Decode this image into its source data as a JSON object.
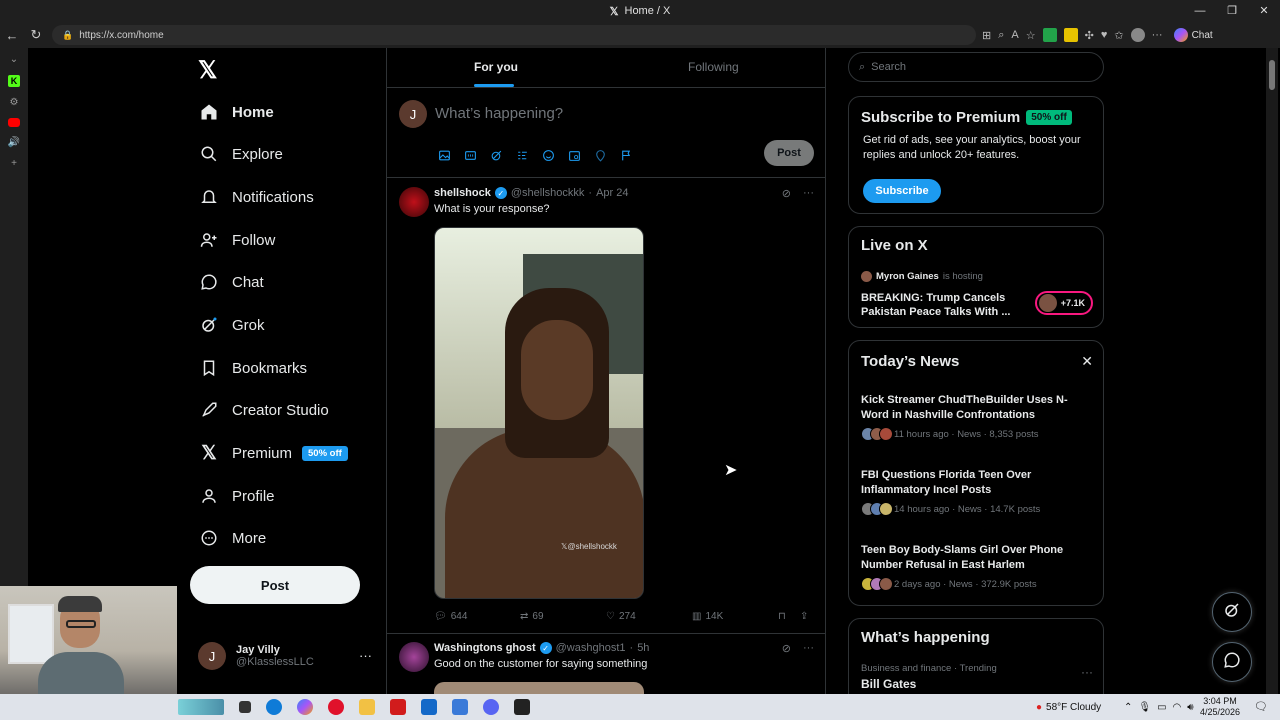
{
  "window": {
    "title": "Home / X",
    "controls": [
      "—",
      "❐",
      "✕"
    ]
  },
  "browser": {
    "url": "https://x.com/home",
    "chat_label": "Chat"
  },
  "nav": {
    "items": [
      {
        "label": "Home",
        "icon": "home-icon"
      },
      {
        "label": "Explore",
        "icon": "search-icon"
      },
      {
        "label": "Notifications",
        "icon": "bell-icon"
      },
      {
        "label": "Follow",
        "icon": "person-plus-icon"
      },
      {
        "label": "Chat",
        "icon": "chat-bubble-icon"
      },
      {
        "label": "Grok",
        "icon": "grok-icon"
      },
      {
        "label": "Bookmarks",
        "icon": "bookmark-icon"
      },
      {
        "label": "Creator Studio",
        "icon": "rocket-icon"
      },
      {
        "label": "Premium",
        "icon": "x-logo-icon",
        "badge": "50% off"
      },
      {
        "label": "Profile",
        "icon": "person-icon"
      },
      {
        "label": "More",
        "icon": "more-circle-icon"
      }
    ],
    "post_label": "Post",
    "account": {
      "name": "Jay Villy",
      "handle": "@KlasslessLLC",
      "initial": "J"
    }
  },
  "feed": {
    "tabs": [
      {
        "label": "For you",
        "active": true
      },
      {
        "label": "Following",
        "active": false
      }
    ],
    "compose": {
      "placeholder": "What’s happening?",
      "post_label": "Post",
      "avatar_initial": "J"
    },
    "tweets": [
      {
        "name": "shellshock",
        "handle": "@shellshockkk",
        "time": "Apr 24",
        "text": "What is your response?",
        "watermark": "𝕏@shellshockk",
        "replies": "644",
        "reposts": "69",
        "likes": "274",
        "views": "14K"
      },
      {
        "name": "Washingtons ghost",
        "handle": "@washghost1",
        "time": "5h",
        "text": "Good on the customer for saying something"
      }
    ]
  },
  "sidebar": {
    "search_placeholder": "Search",
    "premium": {
      "title": "Subscribe to Premium",
      "badge": "50% off",
      "desc": "Get rid of ads, see your analytics, boost your replies and unlock 20+ features.",
      "button": "Subscribe"
    },
    "live": {
      "title": "Live on X",
      "host": "Myron Gaines",
      "host_suffix": "is hosting",
      "headline": "BREAKING: Trump Cancels Pakistan Peace Talks With ...",
      "count": "+7.1K"
    },
    "news": {
      "title": "Today’s News",
      "items": [
        {
          "headline": "Kick Streamer ChudTheBuilder Uses N-Word in Nashville Confrontations",
          "meta": "11 hours ago · News · 8,353 posts"
        },
        {
          "headline": "FBI Questions Florida Teen Over Inflammatory Incel Posts",
          "meta": "14 hours ago · News · 14.7K posts"
        },
        {
          "headline": "Teen Boy Body-Slams Girl Over Phone Number Refusal in East Harlem",
          "meta": "2 days ago · News · 372.9K posts"
        }
      ]
    },
    "happening": {
      "title": "What’s happening",
      "category": "Business and finance · Trending",
      "trend": "Bill Gates"
    }
  },
  "taskbar": {
    "weather": "58°F  Cloudy",
    "time": "3:04 PM",
    "date": "4/25/2026"
  },
  "colors": {
    "accent": "#1d9bf0",
    "premium_badge": "#00ba7c",
    "live_ring": "#f91880",
    "background": "#000000"
  }
}
